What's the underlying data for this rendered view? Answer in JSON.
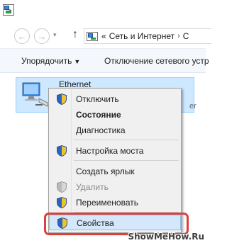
{
  "address_bar": {
    "breadcrumb": [
      "«",
      "Сеть и Интернет",
      "С"
    ],
    "back_glyph": "←",
    "forward_glyph": "→",
    "up_glyph": "↑"
  },
  "toolbar": {
    "organize_label": "Упорядочить",
    "disable_label": "Отключение сетевого устр"
  },
  "adapter": {
    "name": "Ethernet",
    "description_fragment": "er"
  },
  "context_menu": {
    "items": [
      {
        "label": "Отключить",
        "icon": "uac-shield-icon"
      },
      {
        "label": "Состояние"
      },
      {
        "label": "Диагностика"
      },
      {
        "label": "Настройка моста",
        "icon": "uac-shield-icon"
      },
      {
        "label": "Создать ярлык"
      },
      {
        "label": "Удалить",
        "icon": "uac-shield-icon"
      },
      {
        "label": "Переименовать",
        "icon": "uac-shield-icon"
      },
      {
        "label": "Свойства",
        "icon": "uac-shield-icon"
      }
    ]
  },
  "watermark": "ShowMeHow.Ru",
  "colors": {
    "selection": "#cde8ff",
    "menu_highlight": "#d5e8fb",
    "callout": "#d9413b",
    "menu_background": "#f0f0f0"
  }
}
